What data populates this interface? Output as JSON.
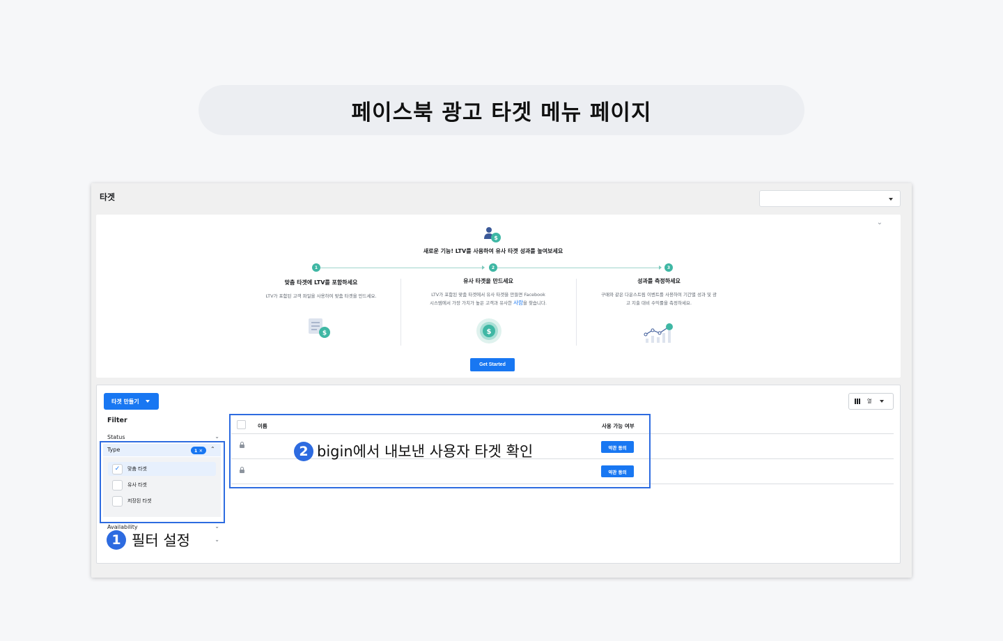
{
  "page_title": "페이스북 광고 타겟 메뉴 페이지",
  "window": {
    "title": "타겟",
    "top_select_value": ""
  },
  "promo": {
    "collapse_icon": "chevron-down-icon",
    "heading": "새로운 기능! LTV를 사용하여 유사 타겟 성과를 높여보세요",
    "steps": [
      {
        "number": "1",
        "title": "맞춤 타겟에 LTV를 포함하세요",
        "desc": "LTV가 포함된 고객 파일을 사용하여 맞춤 타겟을 만드세요."
      },
      {
        "number": "2",
        "title": "유사 타겟을 만드세요",
        "desc_line1": "LTV가 포함된 맞춤 타겟에서 유사 타겟을 만들면 Facebook",
        "desc_line2_pre": "시스템에서 가장 가치가 높은 고객과 유사한 ",
        "desc_line2_hl": "사람",
        "desc_line2_post": "을 찾습니다."
      },
      {
        "number": "3",
        "title": "성과를 측정하세요",
        "desc_line1": "구매와 같은 다운스트림 이벤트를 사용하여 기간별 성과 및 광",
        "desc_line2": "고 지출 대비 수익률을 측정하세요."
      }
    ],
    "cta": "Get Started",
    "colors": {
      "teal": "#3fb7a4",
      "brand_blue": "#1877f2"
    }
  },
  "toolbar": {
    "create_button": "타겟 만들기",
    "columns_button": "열"
  },
  "filter": {
    "title": "Filter",
    "status_label": "Status",
    "type_label": "Type",
    "type_badge": "1 ✕",
    "availability_label": "Availability",
    "options": [
      {
        "label": "맞춤 타겟",
        "checked": true
      },
      {
        "label": "유사 타겟",
        "checked": false
      },
      {
        "label": "저장된 타겟",
        "checked": false
      }
    ]
  },
  "table": {
    "col_name": "이름",
    "col_availability": "사용 가능 여부",
    "rows": [
      {
        "name": "",
        "action": "약관 동의"
      },
      {
        "name": "",
        "action": "약관 동의"
      }
    ]
  },
  "annotations": {
    "one": {
      "number": "1",
      "text": "필터 설정"
    },
    "two": {
      "number": "2",
      "text": "bigin에서 내보낸 사용자 타겟 확인"
    },
    "color": "#2d6be0"
  }
}
